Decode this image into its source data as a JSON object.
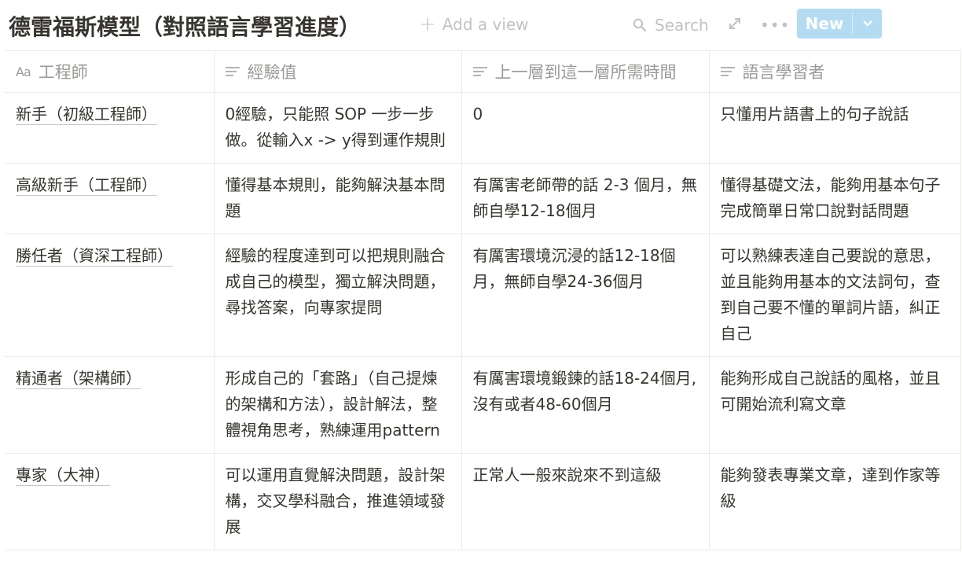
{
  "title": "德雷福斯模型（對照語言學習進度）",
  "toolbar": {
    "add_view": "Add a view",
    "search": "Search",
    "new_label": "New"
  },
  "columns": [
    {
      "label": "工程師",
      "icon": "text-property-icon"
    },
    {
      "label": "經驗值",
      "icon": "text-lines-icon"
    },
    {
      "label": "上一層到這一層所需時間",
      "icon": "text-lines-icon"
    },
    {
      "label": "語言學習者",
      "icon": "text-lines-icon"
    }
  ],
  "rows": [
    [
      "新手（初級工程師）",
      "0經驗，只能照 SOP 一步一步做。從輸入x -> y得到運作規則",
      "0",
      "只懂用片語書上的句子說話"
    ],
    [
      "高級新手（工程師）",
      "懂得基本規則，能夠解決基本問題",
      "有厲害老師帶的話 2-3 個月，無師自學12-18個月",
      "懂得基礎文法，能夠用基本句子完成簡單日常口說對話問題"
    ],
    [
      "勝任者（資深工程師）",
      "經驗的程度達到可以把規則融合成自己的模型，獨立解決問題，尋找答案，向專家提問",
      "有厲害環境沉浸的話12-18個月，無師自學24-36個月",
      "可以熟練表達自己要說的意思，並且能夠用基本的文法詞句，查到自己要不懂的單詞片語，糾正自己"
    ],
    [
      "精通者（架構師）",
      "形成自己的「套路」（自己提煉的架構和方法），設計解法，整體視角思考，熟練運用pattern",
      "有厲害環境鍛鍊的話18-24個月, 沒有或者48-60個月",
      "能夠形成自己說話的風格，並且可開始流利寫文章"
    ],
    [
      "專家（大神）",
      "可以運用直覺解決問題，設計架構，交叉學科融合，推進領域發展",
      "正常人一般來說來不到這級",
      "能夠發表專業文章，達到作家等級"
    ]
  ]
}
